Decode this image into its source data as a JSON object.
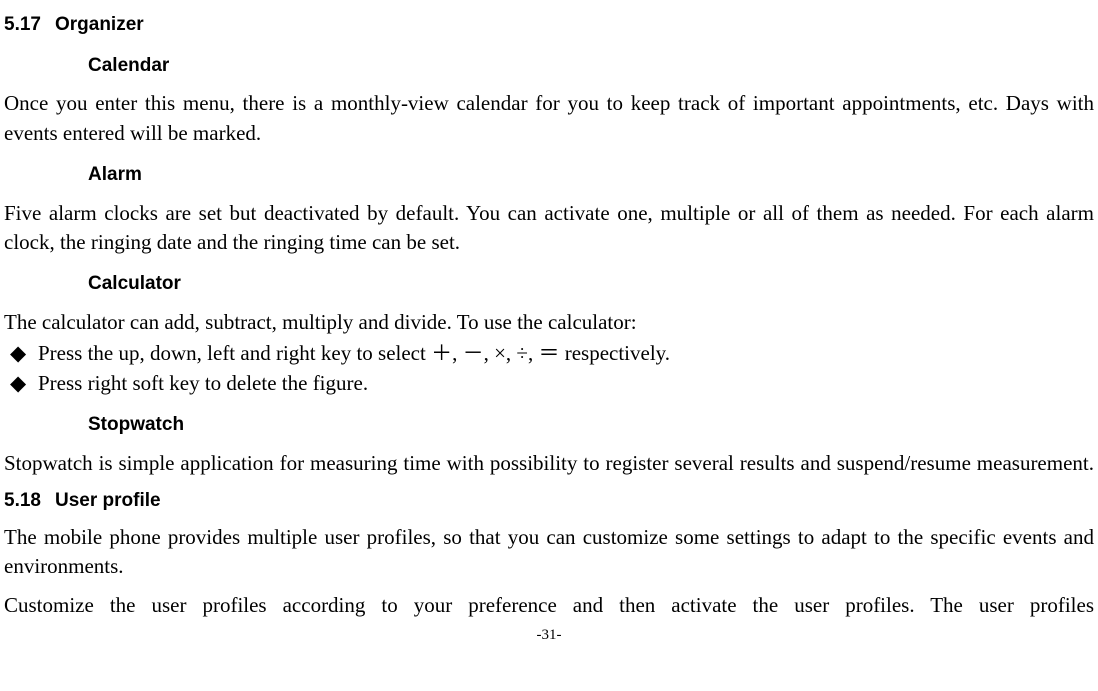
{
  "section517": {
    "number": "5.17",
    "title": "Organizer",
    "calendar": {
      "heading": "Calendar",
      "para": "Once you enter this menu, there is a monthly-view calendar for you to keep track of important appointments, etc. Days with events entered will be marked."
    },
    "alarm": {
      "heading": "Alarm",
      "para": "Five alarm clocks are set but deactivated by default. You can activate one, multiple or all of them as needed. For each alarm clock, the ringing date and the ringing time can be set."
    },
    "calculator": {
      "heading": "Calculator",
      "intro": "The calculator can add, subtract, multiply and divide. To use the calculator:",
      "bullet1": "Press the up, down, left and right key to select ＋, －, ×, ÷, ＝ respectively.",
      "bullet2": "Press right soft key to delete the figure."
    },
    "stopwatch": {
      "heading": "Stopwatch",
      "para": "Stopwatch is simple application for measuring time with possibility to register several results and suspend/resume measurement."
    }
  },
  "section518": {
    "number": "5.18",
    "title": "User profile",
    "para1": "The mobile phone provides multiple user profiles, so that you can customize some settings to adapt to the specific events and environments.",
    "para2": "Customize the user profiles according to your preference and then activate the user profiles. The user profiles"
  },
  "pageNumber": "-31-"
}
